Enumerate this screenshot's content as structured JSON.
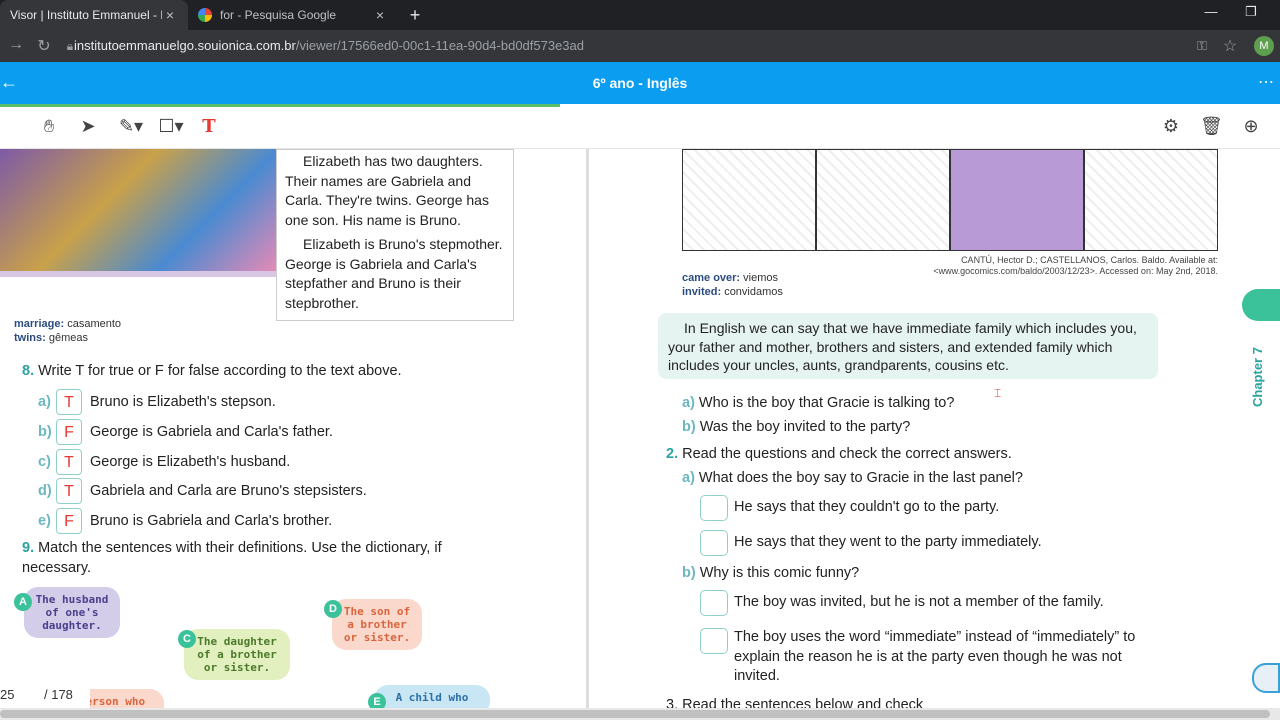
{
  "browser": {
    "tabs": [
      {
        "title": "Visor | Instituto Emmanuel - Ionic",
        "close": "×"
      },
      {
        "title": "for - Pesquisa Google",
        "close": "×"
      }
    ],
    "new_tab": "+",
    "minimize": "—",
    "restore": "❐",
    "url_host": "institutoemmanuelgo.souionica.com.br",
    "url_path": "/viewer/17566ed0-00c1-11ea-90d4-bd0df573e3ad",
    "profile_initial": "M"
  },
  "app": {
    "title": "6º ano - Inglês",
    "back": "←",
    "more": "⋯"
  },
  "toolbar": {
    "text_tool": "T"
  },
  "left": {
    "reading": [
      "Elizabeth has two daughters. Their names are Gabriela and Carla. They're twins. George has one son. His name is Bruno.",
      "Elizabeth is Bruno's stepmother. George is Gabriela and Carla's stepfather and Bruno is their stepbrother."
    ],
    "vocab": [
      {
        "term": "marriage:",
        "meaning": "casamento"
      },
      {
        "term": "twins:",
        "meaning": "gêmeas"
      }
    ],
    "q8": {
      "num": "8.",
      "text": "Write T for true or F for false according to the text above.",
      "items": [
        {
          "letter": "a)",
          "answer": "T",
          "text": "Bruno is Elizabeth's stepson."
        },
        {
          "letter": "b)",
          "answer": "F",
          "text": "George is Gabriela and Carla's father."
        },
        {
          "letter": "c)",
          "answer": "T",
          "text": "George is Elizabeth's husband."
        },
        {
          "letter": "d)",
          "answer": "T",
          "text": "Gabriela and Carla are Bruno's stepsisters."
        },
        {
          "letter": "e)",
          "answer": "F",
          "text": "Bruno is Gabriela and Carla's brother."
        }
      ]
    },
    "q9": {
      "num": "9.",
      "text": "Match the sentences with their definitions. Use the dictionary, if necessary."
    },
    "bubbles": [
      {
        "letter": "A",
        "text": "The husband of one's daughter."
      },
      {
        "letter": "C",
        "text": "The daughter of a brother or sister."
      },
      {
        "letter": "D",
        "text": "The son of a brother or sister."
      },
      {
        "letter": "E",
        "text": "A child who"
      },
      {
        "letter": "",
        "text": "person who"
      }
    ],
    "pager": {
      "current": "25",
      "total": "/ 178"
    }
  },
  "right": {
    "credit": "CANTÚ, Hector D.; CASTELLANOS, Carlos. Baldo. Available at: <www.gocomics.com/baldo/2003/12/23>. Accessed on: May 2nd, 2018.",
    "vocab": [
      {
        "term": "came over:",
        "meaning": "viemos"
      },
      {
        "term": "invited:",
        "meaning": "convidamos"
      }
    ],
    "info": "In English we can say that we have immediate family which includes you, your father and mother, brothers and sisters, and extended family which includes your uncles, aunts, grandparents, cousins etc.",
    "q1": [
      {
        "letter": "a)",
        "text": "Who is the boy that Gracie is talking to?"
      },
      {
        "letter": "b)",
        "text": "Was the boy invited to the party?"
      }
    ],
    "q2": {
      "num": "2.",
      "text": "Read the questions and check the correct answers.",
      "a": {
        "letter": "a)",
        "text": "What does the boy say to Gracie in the last panel?",
        "options": [
          "He says that they couldn't go to the party.",
          "He says that they went to the party immediately."
        ]
      },
      "b": {
        "letter": "b)",
        "text": "Why is this comic funny?",
        "options": [
          "The boy was invited, but he is not a member of the family.",
          "The boy uses the word “immediate” instead of “immediately” to explain the reason he is at the party even though he was not invited."
        ]
      }
    },
    "q3_partial": "3. Read the sentences below and check",
    "chapter": "Chapter 7"
  }
}
